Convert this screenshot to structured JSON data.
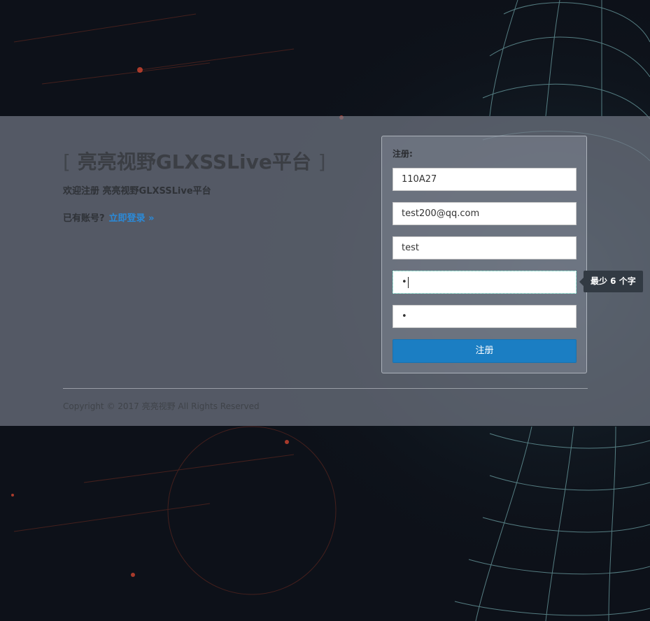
{
  "brand": {
    "bracket_open": "[",
    "title": "亮亮视野GLXSSLive平台",
    "bracket_close": "]",
    "subtitle": "欢迎注册 亮亮视野GLXSSLive平台"
  },
  "login_prompt": {
    "text": "已有账号?",
    "link": "立即登录 »"
  },
  "form": {
    "label": "注册:",
    "fields": [
      {
        "name": "username",
        "value": "110A27"
      },
      {
        "name": "email",
        "value": "test200@qq.com"
      },
      {
        "name": "nickname",
        "value": "test"
      },
      {
        "name": "password",
        "value": "•"
      },
      {
        "name": "confirm_password",
        "value": "•"
      }
    ],
    "submit_label": "注册",
    "tooltip": "最少 6 个字"
  },
  "footer": {
    "copyright": "Copyright © 2017 亮亮视野 All Rights Reserved"
  },
  "colors": {
    "accent": "#1b7ec3",
    "link": "#2b8ad8",
    "tooltip_bg": "#323a43"
  }
}
